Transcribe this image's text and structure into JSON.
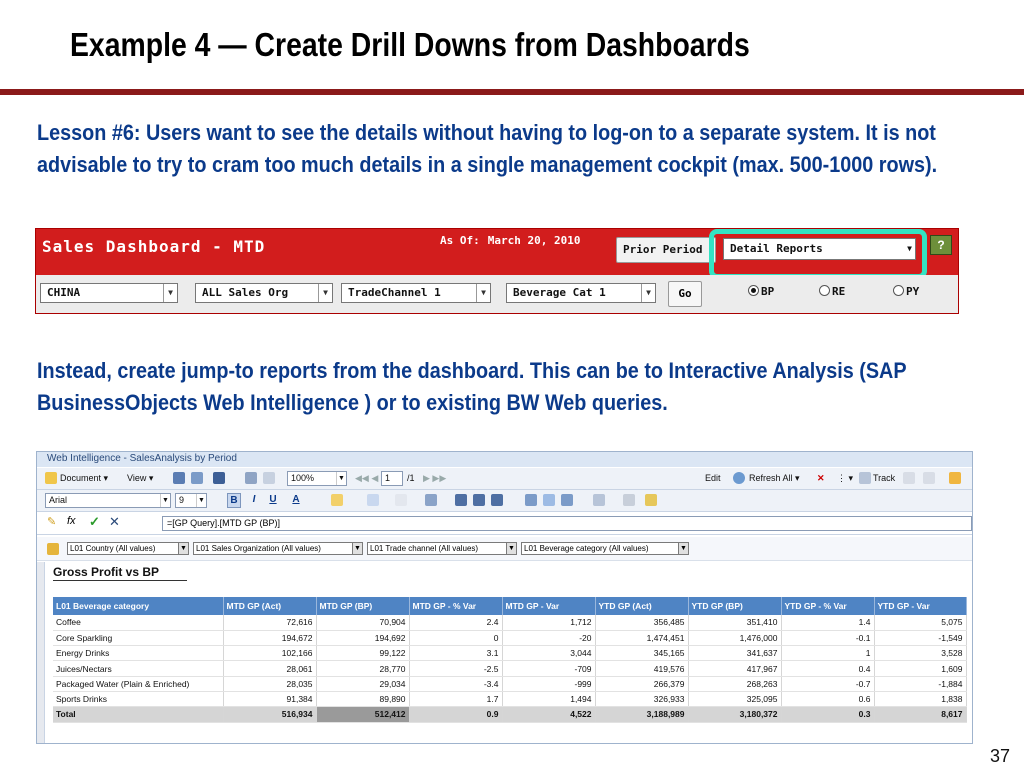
{
  "slide": {
    "title": "Example 4 — Create Drill Downs from Dashboards",
    "lesson": "Lesson #6:  Users want to see the details without having to log-on to a separate system. It is not advisable to try to cram too much details in a single management cockpit (max. 500-1000 rows).",
    "instead": "Instead, create jump-to reports from the dashboard. This can be to Interactive Analysis (SAP BusinessObjects Web Intelligence ) or to existing BW Web queries.",
    "page_number": "37"
  },
  "dashboard": {
    "title": "Sales Dashboard - MTD",
    "as_of_label": "As Of:",
    "as_of_date": "March 20, 2010",
    "prior_period_button": "Prior Period",
    "detail_reports_select": "Detail Reports",
    "help_icon": "?",
    "filters": [
      {
        "value": "CHINA"
      },
      {
        "value": "ALL Sales Org"
      },
      {
        "value": "TradeChannel 1"
      },
      {
        "value": "Beverage Cat 1"
      }
    ],
    "go_button": "Go",
    "radios": [
      {
        "label": "BP",
        "selected": true
      },
      {
        "label": "RE",
        "selected": false
      },
      {
        "label": "PY",
        "selected": false
      }
    ],
    "colors": {
      "header": "#d21d1d",
      "highlight": "#33e3c3"
    }
  },
  "webi": {
    "window_title": "Web Intelligence - SalesAnalysis by Period",
    "toolbar1": {
      "document": "Document",
      "view": "View",
      "zoom": "100%",
      "page": "1",
      "page_of": "/1",
      "edit": "Edit",
      "refresh_all": "Refresh All",
      "track": "Track"
    },
    "toolbar2": {
      "font": "Arial",
      "size": "9",
      "bold": "B",
      "italic": "I",
      "underline": "U"
    },
    "formula": "=[GP Query].[MTD GP (BP)]",
    "input_controls": [
      "L01 Country (All values)",
      "L01 Sales Organization (All values)",
      "L01 Trade channel (All values)",
      "L01 Beverage category (All values)"
    ],
    "report": {
      "title": "Gross Profit vs BP",
      "columns": [
        "L01 Beverage category",
        "MTD GP (Act)",
        "MTD GP (BP)",
        "MTD GP - % Var",
        "MTD GP - Var",
        "YTD GP (Act)",
        "YTD GP (BP)",
        "YTD GP - % Var",
        "YTD GP - Var"
      ],
      "rows": [
        [
          "Coffee",
          "72,616",
          "70,904",
          "2.4",
          "1,712",
          "356,485",
          "351,410",
          "1.4",
          "5,075"
        ],
        [
          "Core Sparkling",
          "194,672",
          "194,692",
          "0",
          "-20",
          "1,474,451",
          "1,476,000",
          "-0.1",
          "-1,549"
        ],
        [
          "Energy Drinks",
          "102,166",
          "99,122",
          "3.1",
          "3,044",
          "345,165",
          "341,637",
          "1",
          "3,528"
        ],
        [
          "Juices/Nectars",
          "28,061",
          "28,770",
          "-2.5",
          "-709",
          "419,576",
          "417,967",
          "0.4",
          "1,609"
        ],
        [
          "Packaged Water (Plain & Enriched)",
          "28,035",
          "29,034",
          "-3.4",
          "-999",
          "266,379",
          "268,263",
          "-0.7",
          "-1,884"
        ],
        [
          "Sports Drinks",
          "91,384",
          "89,890",
          "1.7",
          "1,494",
          "326,933",
          "325,095",
          "0.6",
          "1,838"
        ]
      ],
      "total": [
        "Total",
        "516,934",
        "512,412",
        "0.9",
        "4,522",
        "3,188,989",
        "3,180,372",
        "0.3",
        "8,617"
      ]
    }
  }
}
